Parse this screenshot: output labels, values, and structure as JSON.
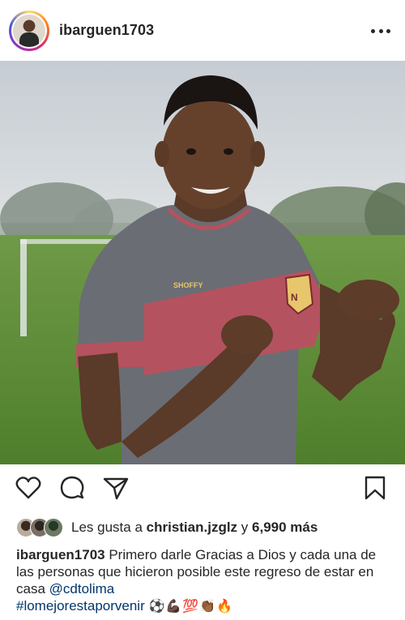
{
  "header": {
    "username": "ibarguen1703",
    "avatar_icon": "profile-avatar",
    "more_icon": "more-horizontal-icon"
  },
  "photo": {
    "sponsor_text": "SHOFFY"
  },
  "actions": {
    "like_icon": "heart-icon",
    "comment_icon": "comment-icon",
    "share_icon": "paper-plane-icon",
    "save_icon": "bookmark-icon"
  },
  "likes": {
    "prefix": "Les gusta a",
    "user": "christian.jzglz",
    "connector": "y",
    "count": "6,990 más"
  },
  "caption": {
    "username": "ibarguen1703",
    "text": "Primero darle Gracias a Dios y cada una de las personas que hicieron  posible este regreso de estar en casa",
    "mention": "@cdtolima",
    "hashtag": "#lomejorestaporvenir",
    "emojis": "⚽💪🏿💯👏🏾🔥"
  }
}
